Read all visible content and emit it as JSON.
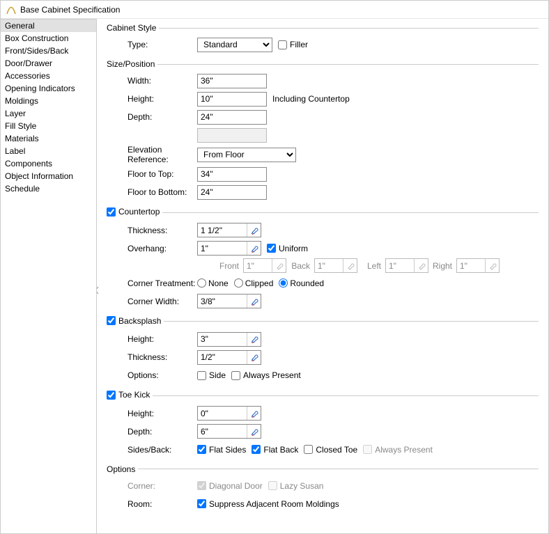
{
  "window": {
    "title": "Base Cabinet Specification"
  },
  "sidebar": {
    "items": [
      "General",
      "Box Construction",
      "Front/Sides/Back",
      "Door/Drawer",
      "Accessories",
      "Opening Indicators",
      "Moldings",
      "Layer",
      "Fill Style",
      "Materials",
      "Label",
      "Components",
      "Object Information",
      "Schedule"
    ],
    "selected_index": 0
  },
  "cabinet_style": {
    "legend": "Cabinet Style",
    "type_label": "Type:",
    "type_value": "Standard",
    "type_options": [
      "Standard"
    ],
    "filler_label": "Filler",
    "filler_checked": false
  },
  "size_position": {
    "legend": "Size/Position",
    "width_label": "Width:",
    "width": "36\"",
    "height_label": "Height:",
    "height": "10\"",
    "height_note": "Including Countertop",
    "depth_label": "Depth:",
    "depth": "24\"",
    "blank": "",
    "elev_ref_label": "Elevation Reference:",
    "elev_ref": "From Floor",
    "elev_ref_options": [
      "From Floor"
    ],
    "floor_to_top_label": "Floor to Top:",
    "floor_to_top": "34\"",
    "floor_to_bottom_label": "Floor to Bottom:",
    "floor_to_bottom": "24\""
  },
  "countertop": {
    "legend": "Countertop",
    "enabled": true,
    "thickness_label": "Thickness:",
    "thickness": "1 1/2\"",
    "overhang_label": "Overhang:",
    "overhang": "1\"",
    "uniform_label": "Uniform",
    "uniform": true,
    "front_label": "Front",
    "front": "1\"",
    "back_label": "Back",
    "back": "1\"",
    "left_label": "Left",
    "left": "1\"",
    "right_label": "Right",
    "right": "1\"",
    "corner_treatment_label": "Corner Treatment:",
    "corner_none": "None",
    "corner_clipped": "Clipped",
    "corner_rounded": "Rounded",
    "corner_treatment_value": "Rounded",
    "corner_width_label": "Corner Width:",
    "corner_width": "3/8\""
  },
  "backsplash": {
    "legend": "Backsplash",
    "enabled": true,
    "height_label": "Height:",
    "height": "3\"",
    "thickness_label": "Thickness:",
    "thickness": "1/2\"",
    "options_label": "Options:",
    "side_label": "Side",
    "side": false,
    "always_label": "Always Present",
    "always": false
  },
  "toe_kick": {
    "legend": "Toe Kick",
    "enabled": true,
    "height_label": "Height:",
    "height": "0\"",
    "depth_label": "Depth:",
    "depth": "6\"",
    "sides_back_label": "Sides/Back:",
    "flat_sides_label": "Flat Sides",
    "flat_sides": true,
    "flat_back_label": "Flat Back",
    "flat_back": true,
    "closed_toe_label": "Closed Toe",
    "closed_toe": false,
    "always_label": "Always Present",
    "always": false
  },
  "options": {
    "legend": "Options",
    "corner_label": "Corner:",
    "diagonal_door_label": "Diagonal Door",
    "diagonal_door": true,
    "lazy_susan_label": "Lazy Susan",
    "lazy_susan": false,
    "room_label": "Room:",
    "suppress_label": "Suppress Adjacent Room Moldings",
    "suppress": true
  }
}
